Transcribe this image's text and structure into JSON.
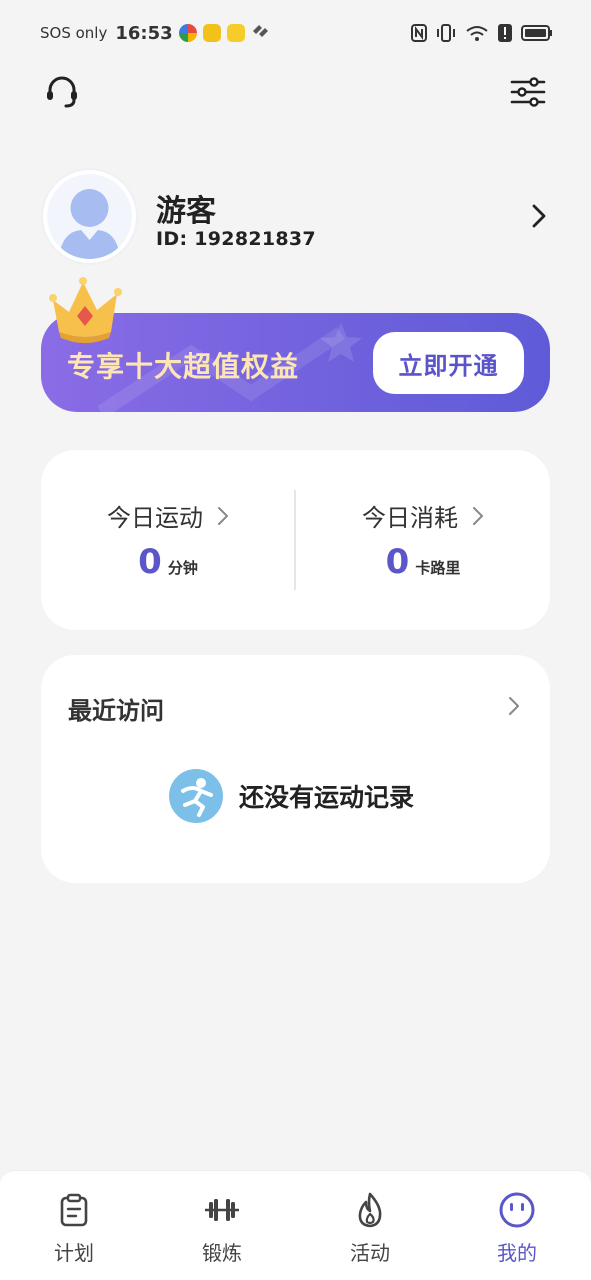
{
  "status_bar": {
    "carrier": "SOS only",
    "time": "16:53",
    "icons": [
      "nfc-icon",
      "vibrate-icon",
      "wifi-icon",
      "alert-icon",
      "battery-icon"
    ]
  },
  "header": {
    "support_icon": "headset-icon",
    "settings_icon": "sliders-icon"
  },
  "profile": {
    "name": "游客",
    "id_text": "ID: 192821837"
  },
  "vip": {
    "text": "专享十大超值权益",
    "button_label": "立即开通"
  },
  "stats": {
    "exercise": {
      "title": "今日运动",
      "value": "0",
      "unit": "分钟"
    },
    "calories": {
      "title": "今日消耗",
      "value": "0",
      "unit": "卡路里"
    }
  },
  "recent": {
    "title": "最近访问",
    "empty_text": "还没有运动记录"
  },
  "bottom_nav": {
    "items": [
      {
        "label": "计划",
        "icon": "clipboard-icon"
      },
      {
        "label": "锻炼",
        "icon": "dumbbell-icon"
      },
      {
        "label": "活动",
        "icon": "flame-icon"
      },
      {
        "label": "我的",
        "icon": "smiley-icon"
      }
    ],
    "active_index": 3
  },
  "colors": {
    "accent": "#5b57c9",
    "vip_gradient_start": "#8a6ce6",
    "vip_gradient_end": "#5f5bd8",
    "vip_text": "#fde6b4",
    "background": "#f4f4f4"
  }
}
